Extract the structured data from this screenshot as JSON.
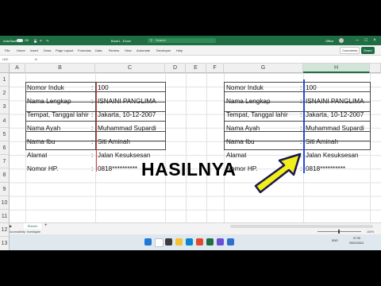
{
  "titlebar": {
    "autosave_label": "AutoSave",
    "toggle_state": "Off",
    "doc_title": "Book1 - Excel",
    "search_placeholder": "Search",
    "account": "Office"
  },
  "ribbon": {
    "tabs": [
      "File",
      "Home",
      "Insert",
      "Draw",
      "Page Layout",
      "Formulas",
      "Data",
      "Review",
      "View",
      "Automate",
      "Developer",
      "Help"
    ],
    "comments_label": "Comments",
    "share_label": "Share"
  },
  "formula_bar": {
    "name_box": "H20",
    "fx_label": "fx"
  },
  "columns_left": [
    "A",
    "B",
    "C",
    "D",
    "E",
    "F"
  ],
  "columns_right": [
    "G",
    "H"
  ],
  "rows": [
    "1",
    "2",
    "3",
    "4",
    "5",
    "6",
    "7",
    "8",
    "9",
    "10",
    "11",
    "12",
    "13"
  ],
  "table_left": {
    "labels": [
      "Nomor Induk",
      "Nama Lengkap",
      "Tempat, Tanggal lahir",
      "Nama Ayah",
      "Nama Ibu",
      "Alamat",
      "Nomor HP."
    ],
    "separators": [
      ":",
      ":",
      ":",
      ":",
      ":",
      ":",
      ":"
    ],
    "values": [
      "100",
      "ISNAINI PANGLIMA",
      "Jakarta, 10-12-2007",
      "Muhammad Supardi",
      "Siti Aminah",
      "Jalan Kesuksesan",
      "0818**********"
    ]
  },
  "table_right": {
    "labels": [
      "Nomor Induk",
      "Nama Lengkap",
      "Tempat, Tanggal lahir",
      "Nama Ayah",
      "Nama Ibu",
      "Alamat",
      "Nomor HP."
    ],
    "separators": [
      ":",
      ":",
      ":",
      ":",
      ":",
      ":",
      ":"
    ],
    "values": [
      "100",
      "ISNAINI PANGLIMA",
      "Jakarta, 10-12-2007",
      "Muhammad Supardi",
      "Siti Aminah",
      "Jalan Kesuksesan",
      "0818**********"
    ]
  },
  "callout": {
    "text": "HASILNYA",
    "arrow_color": "#f2ee1c"
  },
  "sheets": {
    "active": "Sheet1",
    "add_label": "+"
  },
  "status": {
    "accessibility": "Accessibility: Investigate",
    "zoom": "100%"
  },
  "taskbar": {
    "time": "07:30",
    "date": "25/01/2024",
    "lang": "ENG"
  },
  "colors": {
    "excel_green": "#1f6e43",
    "red_line": "#e23b3b",
    "blue_line": "#2b4bd6"
  }
}
